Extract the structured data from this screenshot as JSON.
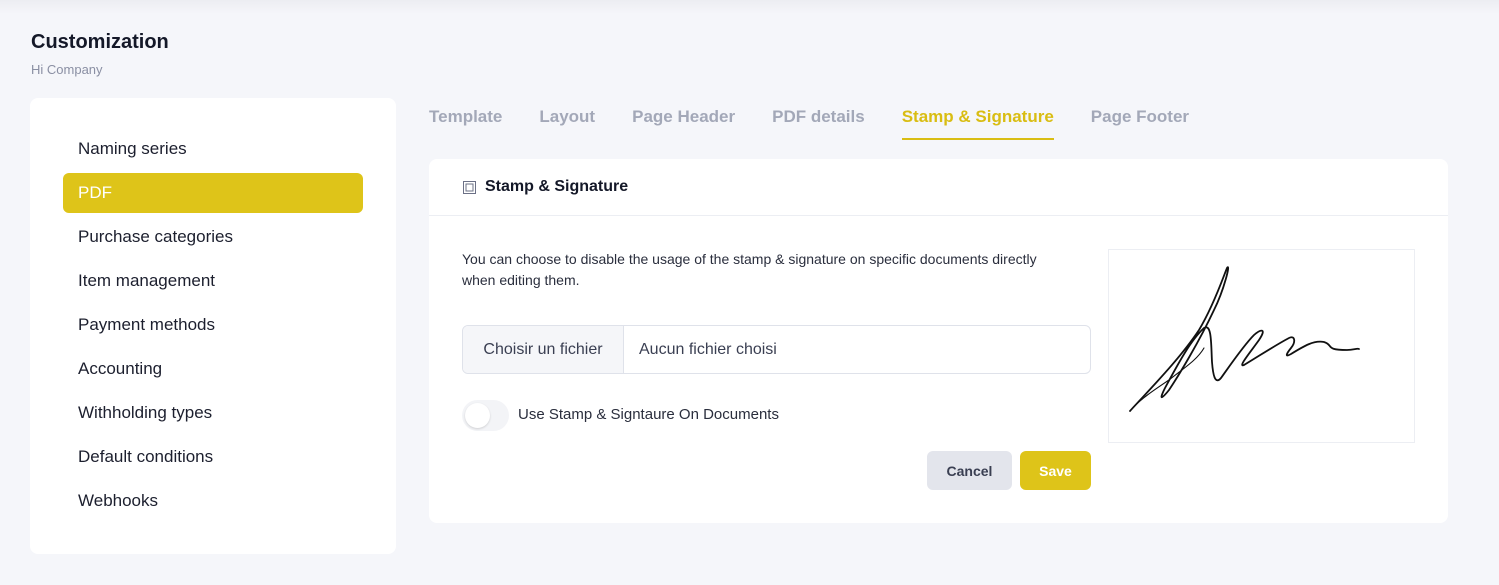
{
  "page": {
    "title": "Customization",
    "subtitle": "Hi Company"
  },
  "sidebar": {
    "items": [
      {
        "label": "Naming series",
        "active": false
      },
      {
        "label": "PDF",
        "active": true
      },
      {
        "label": "Purchase categories",
        "active": false
      },
      {
        "label": "Item management",
        "active": false
      },
      {
        "label": "Payment methods",
        "active": false
      },
      {
        "label": "Accounting",
        "active": false
      },
      {
        "label": "Withholding types",
        "active": false
      },
      {
        "label": "Default conditions",
        "active": false
      },
      {
        "label": "Webhooks",
        "active": false
      }
    ]
  },
  "tabs": [
    {
      "label": "Template",
      "active": false
    },
    {
      "label": "Layout",
      "active": false
    },
    {
      "label": "Page Header",
      "active": false
    },
    {
      "label": "PDF details",
      "active": false
    },
    {
      "label": "Stamp & Signature",
      "active": true
    },
    {
      "label": "Page Footer",
      "active": false
    }
  ],
  "card": {
    "icon": "stamp-icon",
    "title": "Stamp & Signature",
    "description": "You can choose to disable the usage of the stamp & signature on specific documents directly when editing them.",
    "file_input": {
      "button_label": "Choisir un fichier",
      "status": "Aucun fichier choisi"
    },
    "toggle": {
      "label": "Use Stamp & Signtaure On Documents",
      "checked": false
    },
    "cancel_label": "Cancel",
    "save_label": "Save",
    "signature_preview": "signature-image"
  },
  "colors": {
    "accent": "#dec419",
    "background": "#f5f6fa",
    "muted_tab": "#a3a8b8"
  }
}
